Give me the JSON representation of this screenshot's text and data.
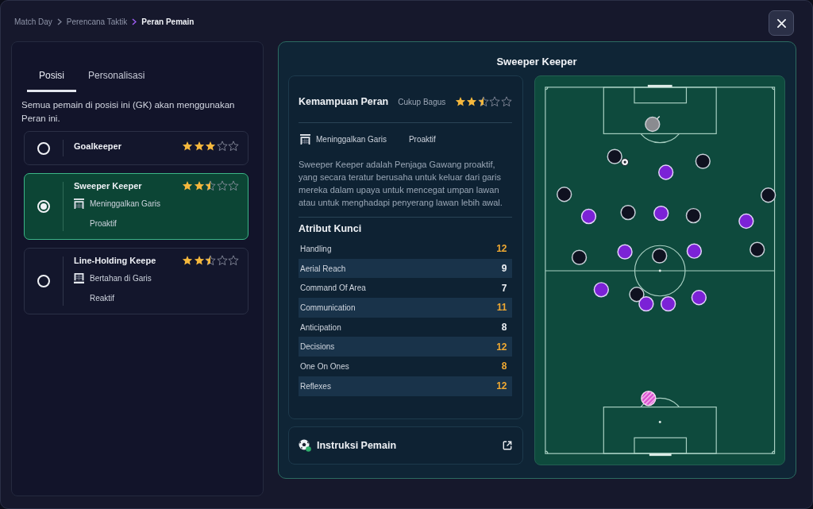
{
  "breadcrumb": [
    {
      "label": "Match Day",
      "current": false
    },
    {
      "label": "Perencana Taktik",
      "current": false
    },
    {
      "label": "Peran Pemain",
      "current": true
    }
  ],
  "left_panel": {
    "tabs": [
      {
        "label": "Posisi",
        "selected": true
      },
      {
        "label": "Personalisasi",
        "selected": false
      }
    ],
    "description": "Semua pemain di posisi ini (GK) akan menggunakan Peran ini.",
    "roles": [
      {
        "name": "Goalkeeper",
        "stars": 3,
        "selected": false
      },
      {
        "name": "Sweeper Keeper",
        "stars": 2.5,
        "selected": true,
        "line": {
          "kind": "leave",
          "label": "Meninggalkan Garis"
        },
        "style": "Proaktif"
      },
      {
        "name": "Line-Holding Keepe",
        "stars": 2.5,
        "selected": false,
        "line": {
          "kind": "hold",
          "label": "Bertahan di Garis"
        },
        "style": "Reaktif"
      }
    ]
  },
  "detail": {
    "title": "Sweeper Keeper",
    "ability": {
      "label": "Kemampuan Peran",
      "rating": "Cukup Bagus",
      "stars": 2.5
    },
    "line": {
      "kind": "leave",
      "label": "Meninggalkan Garis"
    },
    "style": "Proaktif",
    "description": "Sweeper Keeper adalah Penjaga Gawang proaktif, yang secara teratur berusaha untuk keluar dari garis mereka dalam upaya untuk mencegat umpan lawan atau untuk menghadapi penyerang lawan lebih awal.",
    "attributes_title": "Atribut Kunci",
    "attributes": [
      {
        "name": "Handling",
        "value": "12",
        "highlighted": true
      },
      {
        "name": "Aerial Reach",
        "value": "9",
        "highlighted": false
      },
      {
        "name": "Command Of Area",
        "value": "7",
        "highlighted": false
      },
      {
        "name": "Communication",
        "value": "11",
        "highlighted": true
      },
      {
        "name": "Anticipation",
        "value": "8",
        "highlighted": false
      },
      {
        "name": "Decisions",
        "value": "12",
        "highlighted": true
      },
      {
        "name": "One On Ones",
        "value": "8",
        "highlighted": true
      },
      {
        "name": "Reflexes",
        "value": "12",
        "highlighted": true
      }
    ]
  },
  "instructions": {
    "label": "Instruksi Pemain"
  }
}
